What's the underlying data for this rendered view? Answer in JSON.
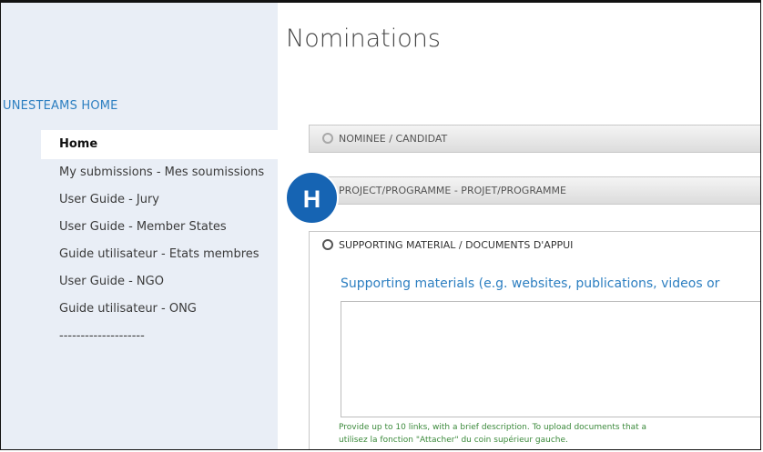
{
  "page": {
    "title": "Nominations"
  },
  "sidebar": {
    "header": "UNESTEAMS HOME",
    "items": [
      {
        "label": "Home"
      },
      {
        "label": "My submissions - Mes soumissions"
      },
      {
        "label": "User Guide - Jury"
      },
      {
        "label": "User Guide - Member States"
      },
      {
        "label": "Guide utilisateur - Etats membres"
      },
      {
        "label": "User Guide - NGO"
      },
      {
        "label": "Guide utilisateur - ONG"
      },
      {
        "label": "--------------------"
      }
    ]
  },
  "sections": [
    {
      "label": "NOMINEE / CANDIDAT"
    },
    {
      "label": "PROJECT/PROGRAMME - PROJET/PROGRAMME"
    },
    {
      "label": "SUPPORTING MATERIAL / DOCUMENTS D'APPUI"
    }
  ],
  "supporting": {
    "field_label": "Supporting materials (e.g. websites, publications, videos or",
    "help_line1": "Provide up to 10 links, with a brief description. To upload documents that a",
    "help_line2": "utilisez la fonction \"Attacher\" du coin supérieur gauche."
  },
  "badge": {
    "letter": "H"
  },
  "colors": {
    "accent": "#2d7fc1",
    "badge": "#1664b3",
    "sidebar_bg": "#e9eef6",
    "help_text": "#3c8a3c"
  }
}
